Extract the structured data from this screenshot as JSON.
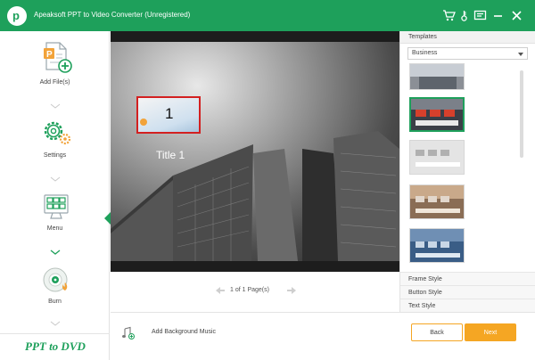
{
  "app": {
    "title": "Apeaksoft PPT to Video Converter (Unregistered)",
    "logo_letter": "p"
  },
  "titlebar_icons": [
    "cart-icon",
    "key-icon",
    "feedback-icon",
    "minimize-icon",
    "close-icon"
  ],
  "sidebar": {
    "steps": [
      {
        "label": "Add File(s)",
        "icon": "add-file-icon"
      },
      {
        "label": "Settings",
        "icon": "settings-gears-icon"
      },
      {
        "label": "Menu",
        "icon": "menu-layout-icon"
      },
      {
        "label": "Burn",
        "icon": "burn-disc-icon"
      }
    ],
    "brand": "PPT to DVD"
  },
  "preview": {
    "thumb_number": "1",
    "slide_title": "Title 1"
  },
  "pager": {
    "text": "1 of 1 Page(s)"
  },
  "bottom": {
    "music_label": "Add Background Music",
    "back_label": "Back",
    "next_label": "Next"
  },
  "templates_panel": {
    "header": "Templates",
    "category": "Business",
    "styles": [
      "Frame Style",
      "Button Style",
      "Text Style"
    ]
  },
  "colors": {
    "accent": "#1ea05b",
    "button": "#f5a623",
    "selection_frame": "#d32020"
  }
}
